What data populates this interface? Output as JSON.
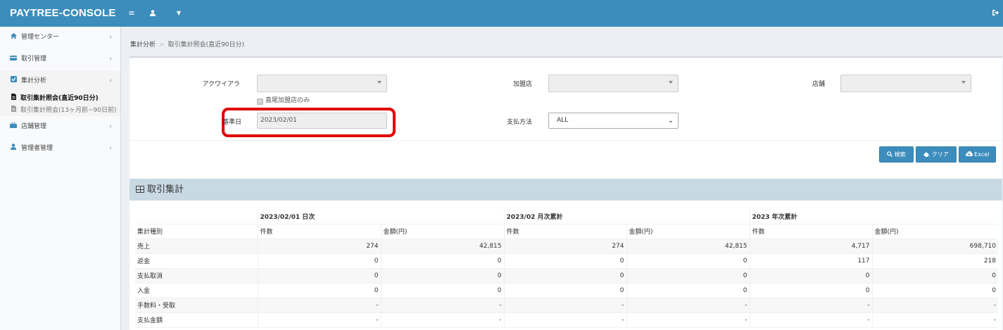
{
  "app": {
    "brand": "PAYTREE-CONSOLE"
  },
  "icons": {
    "menu": "hamburger-icon",
    "user": "user-icon",
    "dropdown": "caret-down-icon",
    "logout": "logout-icon"
  },
  "colors": {
    "topbar": "#3c8dbc",
    "highlight": "#e00000",
    "panel_header": "#c8d9e3"
  },
  "sidebar": {
    "items": [
      {
        "label": "管理センター",
        "icon": "home-icon"
      },
      {
        "label": "取引管理",
        "icon": "card-icon"
      },
      {
        "label": "集計分析",
        "icon": "checkbox-icon"
      },
      {
        "label": "店舗管理",
        "icon": "briefcase-icon"
      },
      {
        "label": "管理者管理",
        "icon": "user-icon"
      }
    ],
    "subitems": [
      {
        "label": "取引集計照会(直近90日分)",
        "active": true
      },
      {
        "label": "取引集計照会(13ヶ月前~90日前)",
        "active": false
      }
    ]
  },
  "breadcrumb": {
    "parent": "集計分析",
    "current": "取引集計照会(直近90日分)"
  },
  "filters": {
    "acquirer_label": "アクワイアラ",
    "acquirer_value": "",
    "direct_only_label": "直尾加盟店のみ",
    "merchant_label": "加盟店",
    "merchant_value": "",
    "store_label": "店舗",
    "store_value": "",
    "base_date_label": "基準日",
    "base_date_value": "2023/02/01",
    "payment_label": "支払方法",
    "payment_value": "ALL"
  },
  "buttons": {
    "search": "検索",
    "clear": "クリア",
    "excel": "Excel"
  },
  "summary": {
    "title": "取引集計",
    "groups": [
      "2023/02/01 日次",
      "2023/02 月次累計",
      "2023 年次累計"
    ],
    "row_header": "集計種別",
    "col_count": "件数",
    "col_amount": "金額(円)",
    "rows": [
      {
        "type": "売上",
        "values": [
          "274",
          "42,815",
          "274",
          "42,815",
          "4,717",
          "698,710"
        ]
      },
      {
        "type": "返金",
        "values": [
          "0",
          "0",
          "0",
          "0",
          "117",
          "218"
        ]
      },
      {
        "type": "支払取消",
        "values": [
          "0",
          "0",
          "0",
          "0",
          "0",
          "0"
        ]
      },
      {
        "type": "入金",
        "values": [
          "0",
          "0",
          "0",
          "0",
          "0",
          "0"
        ]
      },
      {
        "type": "手数料・受取",
        "values": [
          "-",
          "-",
          "-",
          "-",
          "-",
          "-"
        ]
      },
      {
        "type": "支払金額",
        "values": [
          "-",
          "-",
          "-",
          "-",
          "-",
          "-"
        ]
      }
    ]
  }
}
